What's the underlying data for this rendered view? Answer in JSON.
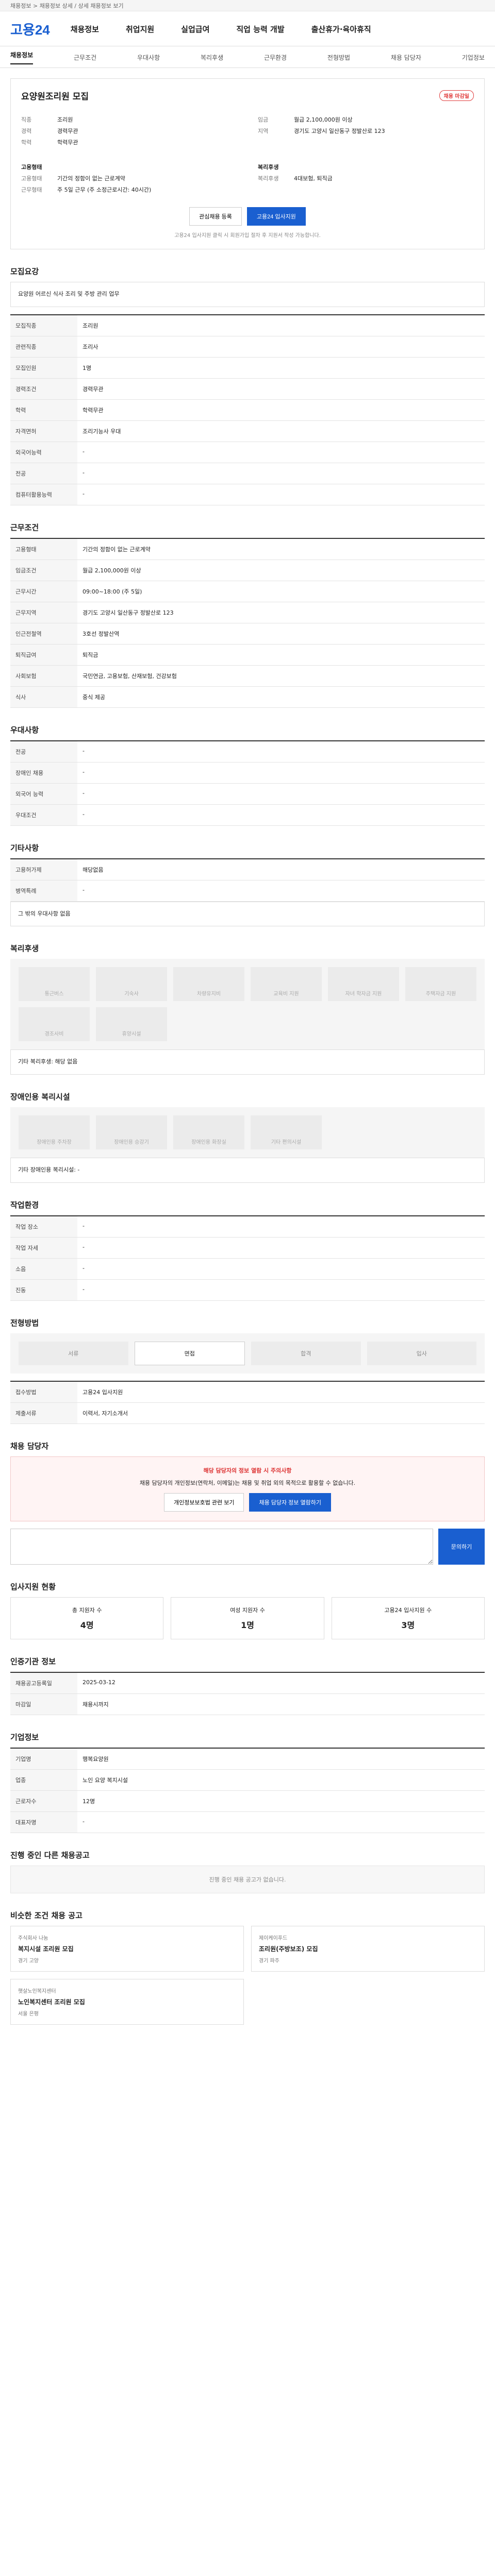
{
  "top": {
    "text": "채용정보 > 채용정보 상세 / 상세 채용정보 보기"
  },
  "header": {
    "logo": "고용24",
    "menu": [
      "채용정보",
      "취업지원",
      "실업급여",
      "직업 능력 개발",
      "출산휴가·육아휴직"
    ]
  },
  "subnav": [
    "채용정보",
    "근무조건",
    "우대사항",
    "복리후생",
    "근무환경",
    "전형방법",
    "채용 담당자",
    "기업정보"
  ],
  "job": {
    "title": "요양원조리원 모집",
    "badge": "채용 마감일",
    "applyBtn": "고용24 입사지원",
    "scrapBtn": "관심채용 등록",
    "note": "고용24 입사지원 클릭 시 회원가입 절차 후 지원서 작성 가능합니다.",
    "left": [
      [
        "직종",
        "조리원"
      ],
      [
        "경력",
        "경력무관"
      ],
      [
        "학력",
        "학력무관"
      ]
    ],
    "right": [
      [
        "임금",
        "월급 2,100,000원 이상"
      ],
      [
        "지역",
        "경기도 고양시 일산동구 정발산로 123"
      ]
    ],
    "l2label": "고용형태",
    "l2": [
      [
        "고용형태",
        "기간의 정함이 없는 근로계약"
      ],
      [
        "근무형태",
        "주 5일 근무 (주 소정근로시간: 40시간)"
      ]
    ],
    "r2label": "복리후생",
    "r2": [
      [
        "복리후생",
        "4대보험, 퇴직금"
      ]
    ]
  },
  "sections": {
    "qual": {
      "h": "모집요강",
      "desc": "요양원 어르신 식사 조리 및 주방 관리 업무",
      "rows": [
        [
          "모집직종",
          "조리원"
        ],
        [
          "관련직종",
          "조리사"
        ],
        [
          "모집인원",
          "1명"
        ],
        [
          "경력조건",
          "경력무관"
        ],
        [
          "학력",
          "학력무관"
        ],
        [
          "자격면허",
          "조리기능사 우대"
        ],
        [
          "외국어능력",
          "-"
        ],
        [
          "전공",
          "-"
        ],
        [
          "컴퓨터활용능력",
          "-"
        ]
      ]
    },
    "cond": {
      "h": "근무조건",
      "rows": [
        [
          "고용형태",
          "기간의 정함이 없는 근로계약"
        ],
        [
          "임금조건",
          "월급 2,100,000원 이상"
        ],
        [
          "근무시간",
          "09:00~18:00 (주 5일)"
        ],
        [
          "근무지역",
          "경기도 고양시 일산동구 정발산로 123"
        ],
        [
          "인근전철역",
          "3호선 정발산역"
        ],
        [
          "퇴직급여",
          "퇴직금"
        ],
        [
          "사회보험",
          "국민연금, 고용보험, 산재보험, 건강보험"
        ],
        [
          "식사",
          "중식 제공"
        ]
      ]
    },
    "pref": {
      "h": "우대사항",
      "rows": [
        [
          "전공",
          "-"
        ],
        [
          "장애인 채용",
          "-"
        ],
        [
          "외국어 능력",
          "-"
        ],
        [
          "우대조건",
          "-"
        ]
      ]
    },
    "etc": {
      "h": "기타사항",
      "rows": [
        [
          "고용허가제",
          "해당없음"
        ],
        [
          "병역특례",
          "-"
        ]
      ],
      "text": "그 밖의 우대사항 없음"
    },
    "welfare": {
      "h": "복리후생",
      "items": [
        "통근버스",
        "기숙사",
        "차량유지비",
        "교육비 지원",
        "자녀 학자금 지원",
        "주택자금 지원",
        "경조사비",
        "휴양시설"
      ],
      "text": "기타 복리후생: 해당 없음"
    },
    "env": {
      "h": "장애인용 복리시설",
      "items": [
        "장애인용 주차장",
        "장애인용 승강기",
        "장애인용 화장실",
        "기타 편의시설"
      ],
      "text": "기타 장애인용 복리시설: -"
    },
    "work": {
      "h": "작업환경",
      "rows": [
        [
          "작업 장소",
          "-"
        ],
        [
          "작업 자세",
          "-"
        ],
        [
          "소음",
          "-"
        ],
        [
          "진동",
          "-"
        ]
      ]
    },
    "proc": {
      "h": "전형방법",
      "steps": [
        "서류",
        "면접",
        "합격",
        "입사"
      ],
      "rows": [
        [
          "접수방법",
          "고용24 입사지원"
        ],
        [
          "제출서류",
          "이력서, 자기소개서"
        ]
      ]
    },
    "contact": {
      "h": "채용 담당자",
      "alert": "해당 담당자의 정보 열람 시 주의사항",
      "text": "채용 담당자의 개인정보(연락처, 이메일)는 채용 및 취업 외의 목적으로 활용할 수 없습니다.",
      "b1": "개인정보보호법 관련 보기",
      "b2": "채용 담당자 정보 열람하기",
      "btn": "문의하기"
    },
    "stats": {
      "h": "입사지원 현황",
      "items": [
        [
          "총 지원자 수",
          "4명"
        ],
        [
          "여성 지원자 수",
          "1명"
        ],
        [
          "고용24 입사지원 수",
          "3명"
        ]
      ]
    },
    "info": {
      "h": "인증기관 정보",
      "rows": [
        [
          "채용공고등록일",
          "2025-03-12"
        ],
        [
          "마감일",
          "채용시까지"
        ]
      ]
    },
    "comp": {
      "h": "기업정보",
      "rows": [
        [
          "기업명",
          "행복요양원"
        ],
        [
          "업종",
          "노인 요양 복지시설"
        ],
        [
          "근로자수",
          "12명"
        ],
        [
          "대표자명",
          "-"
        ]
      ]
    },
    "other": {
      "h": "진행 중인 다른 채용공고",
      "empty": "진행 중인 채용 공고가 없습니다."
    },
    "similar": {
      "h": "비슷한 조건 채용 공고",
      "cards": [
        [
          "주식회사 나눔",
          "복지시설 조리원 모집",
          "경기 고양"
        ],
        [
          "제이케이푸드",
          "조리원(주방보조) 모집",
          "경기 파주"
        ],
        [
          "햇살노인복지센터",
          "노인복지센터 조리원 모집",
          "서울 은평"
        ]
      ]
    }
  }
}
